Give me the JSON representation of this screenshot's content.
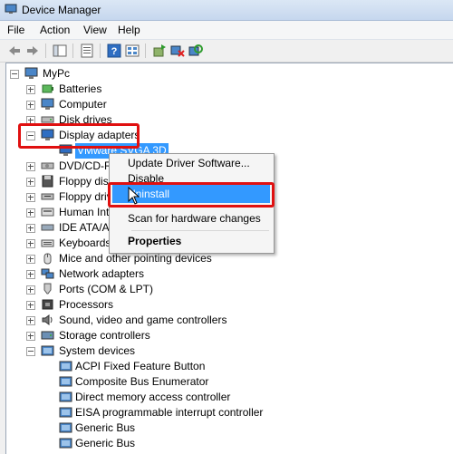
{
  "window": {
    "title": "Device Manager"
  },
  "menu": [
    "File",
    "Action",
    "View",
    "Help"
  ],
  "toolbar": [
    "back-icon",
    "forward-icon",
    "show-hide-console-tree-icon",
    "properties-icon",
    "help-icon",
    "view-icon",
    "update-driver-icon",
    "uninstall-icon",
    "scan-hardware-icon"
  ],
  "tree": {
    "root": "MyPc",
    "items": [
      {
        "label": "Batteries",
        "icon": "battery-icon"
      },
      {
        "label": "Computer",
        "icon": "computer-icon"
      },
      {
        "label": "Disk drives",
        "icon": "disk-drive-icon"
      },
      {
        "label": "Display adapters",
        "icon": "display-adapter-icon",
        "expanded": true,
        "children": [
          "VMware SVGA 3D"
        ]
      },
      {
        "label": "DVD/CD-RO",
        "icon": "dvd-icon"
      },
      {
        "label": "Floppy disk",
        "icon": "floppy-icon"
      },
      {
        "label": "Floppy driv",
        "icon": "floppy-icon"
      },
      {
        "label": "Human Inte",
        "icon": "hid-icon"
      },
      {
        "label": "IDE ATA/AT",
        "icon": "ide-icon"
      },
      {
        "label": "Keyboards",
        "icon": "keyboard-icon"
      },
      {
        "label": "Mice and other pointing devices",
        "icon": "mouse-icon"
      },
      {
        "label": "Network adapters",
        "icon": "network-icon"
      },
      {
        "label": "Ports (COM & LPT)",
        "icon": "port-icon"
      },
      {
        "label": "Processors",
        "icon": "processor-icon"
      },
      {
        "label": "Sound, video and game controllers",
        "icon": "sound-icon"
      },
      {
        "label": "Storage controllers",
        "icon": "storage-icon"
      },
      {
        "label": "System devices",
        "icon": "system-device-icon",
        "expanded": true,
        "children": [
          "ACPI Fixed Feature Button",
          "Composite Bus Enumerator",
          "Direct memory access controller",
          "EISA programmable interrupt controller",
          "Generic Bus",
          "Generic Bus"
        ]
      }
    ]
  },
  "context_menu": {
    "items": [
      "Update Driver Software...",
      "Disable",
      "Uninstall",
      "Scan for hardware changes",
      "Properties"
    ],
    "highlighted": "Uninstall"
  }
}
